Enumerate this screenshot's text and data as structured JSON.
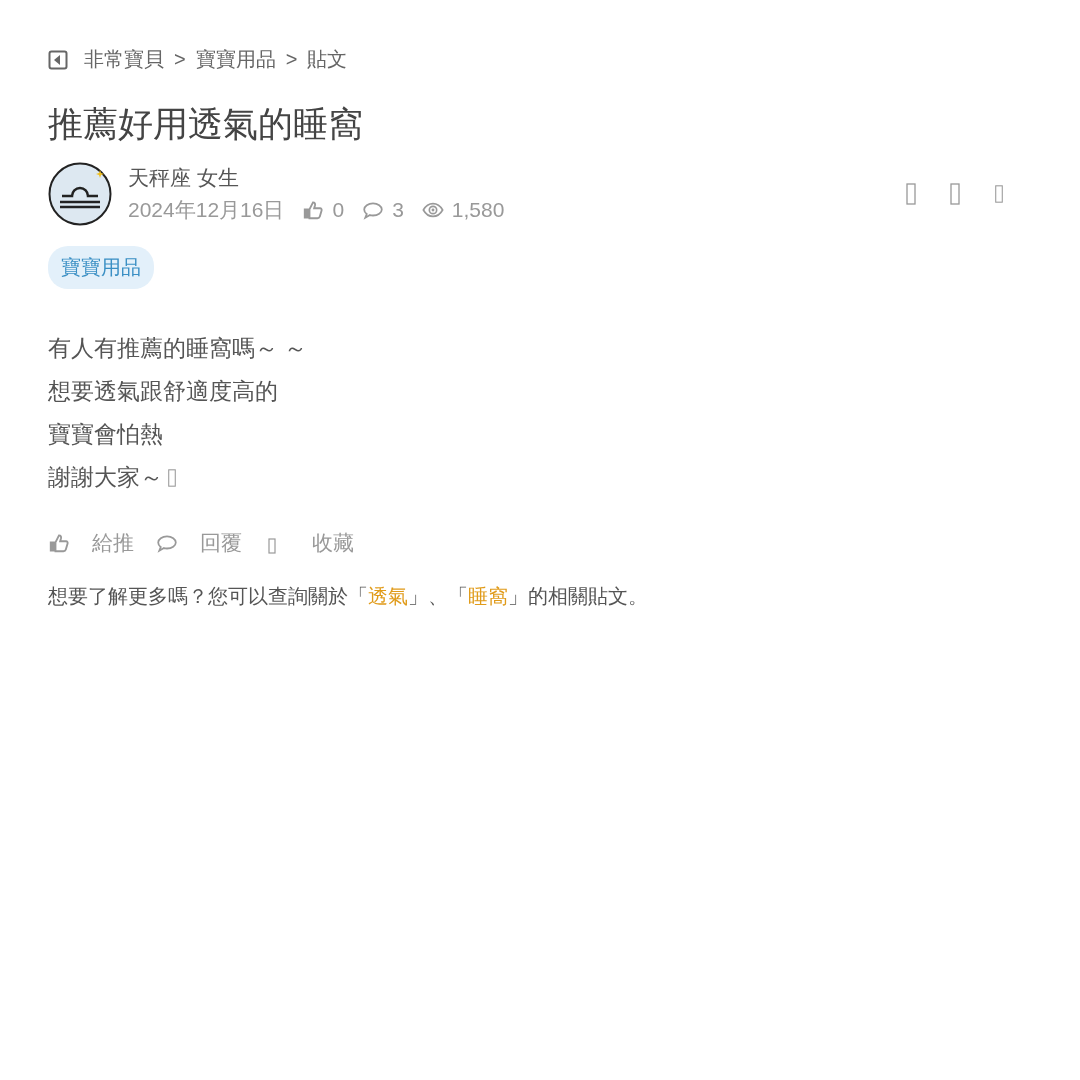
{
  "breadcrumb": [
    "非常寶貝",
    "寶寶用品",
    "貼文"
  ],
  "breadcrumb_separator": ">",
  "title": "推薦好用透氣的睡窩",
  "author": {
    "name": "天秤座 女生",
    "date": "2024年12月16日",
    "likes": "0",
    "comments": "3",
    "views": "1,580"
  },
  "tag": "寶寶用品",
  "body": [
    "有人有推薦的睡窩嗎～ ～",
    "想要透氣跟舒適度高的",
    "寶寶會怕熱",
    "謝謝大家～"
  ],
  "actions": [
    {
      "kind": "like",
      "label": "給推"
    },
    {
      "kind": "reply",
      "label": "回覆"
    },
    {
      "kind": "save",
      "label": "收藏"
    }
  ],
  "related": {
    "prefix": "想要了解更多嗎？您可以查詢關於「",
    "links": [
      "透氣",
      "睡窩"
    ],
    "joiner": "」、「",
    "suffix": "」的相關貼文。"
  }
}
